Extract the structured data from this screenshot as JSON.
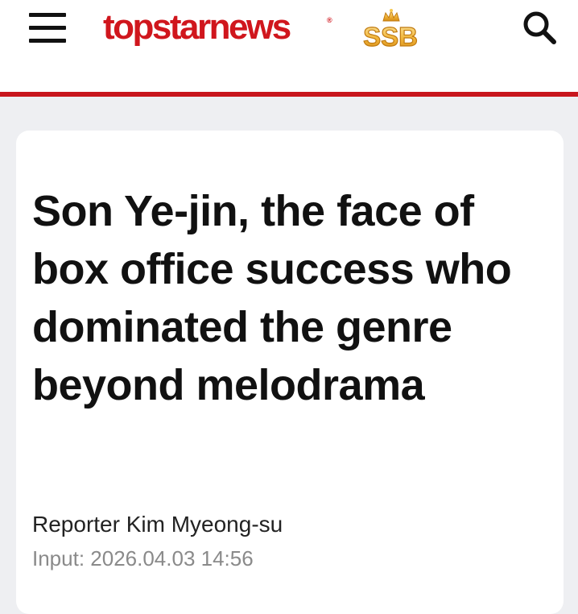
{
  "header": {
    "logo_text": "topstarnews",
    "logo_mark": "®",
    "badge_text": "SSB",
    "menu_icon": "hamburger-menu-icon",
    "search_icon": "search-icon",
    "brand_color": "#c8161d"
  },
  "article": {
    "headline": "Son Ye-jin, the face of box office success who dominated the genre beyond melodrama",
    "reporter": "Reporter Kim Myeong-su",
    "input_date": "Input: 2026.04.03 14:56"
  }
}
